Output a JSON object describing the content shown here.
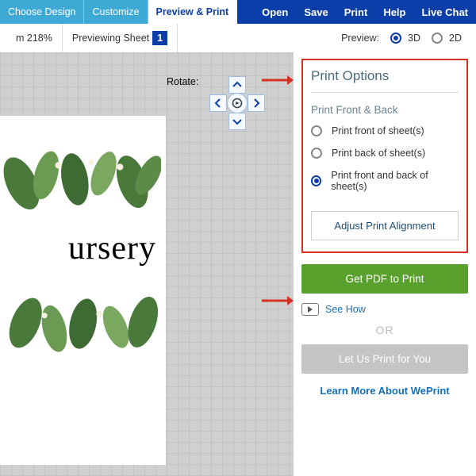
{
  "topbar": {
    "tab_choose": "Choose Design",
    "tab_customize": "Customize",
    "tab_preview": "Preview & Print",
    "open": "Open",
    "save": "Save",
    "print": "Print",
    "help": "Help",
    "chat": "Live Chat"
  },
  "subbar": {
    "zoom": "m 218%",
    "previewing": "Previewing Sheet",
    "sheet_num": "1",
    "preview_label": "Preview:",
    "mode_3d": "3D",
    "mode_2d": "2D"
  },
  "canvas": {
    "rotate_label": "Rotate:",
    "nursery_text": "ursery"
  },
  "panel": {
    "title": "Print Options",
    "subhead": "Print Front & Back",
    "opt_front": "Print front of sheet(s)",
    "opt_back": "Print back of sheet(s)",
    "opt_both": "Print front and back of sheet(s)",
    "adjust": "Adjust Print Alignment"
  },
  "actions": {
    "get_pdf": "Get PDF to Print",
    "see_how": "See How",
    "or": "OR",
    "let_us": "Let Us Print for You",
    "learn": "Learn More About WePrint"
  }
}
